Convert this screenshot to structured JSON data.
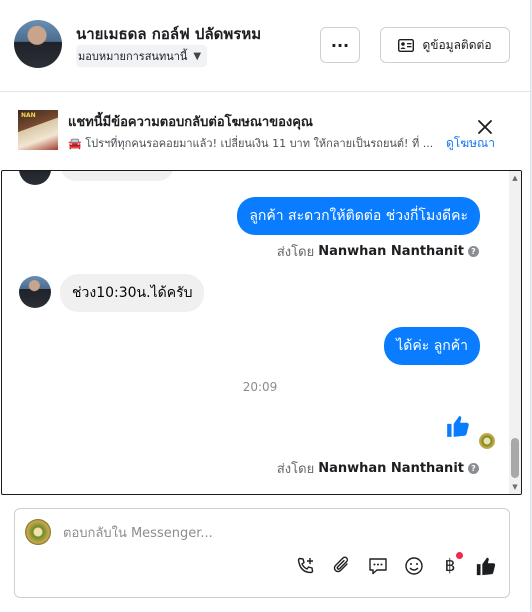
{
  "header": {
    "name": "นายเมธดล กอล์ฟ ปลัดพรหม",
    "assign_label": "มอบหมายการสนทนานี้",
    "more_label": "···",
    "contact_label": "ดูข้อมูลติดต่อ"
  },
  "ad_banner": {
    "title": "แชทนี้มีข้อความตอบกลับต่อโฆษณาของคุณ",
    "subtitle": "🚘 โปรฯที่ทุกคนรอคอยมาแล้ว! เปลี่ยนเงิน 11 บาท ให้กลายเป็นรถยนต์! ที่ ...",
    "link": "ดูโฆษณา",
    "thumb_tag": "NAN"
  },
  "messages": [
    {
      "direction": "out",
      "text": "ลูกค้า สะดวกให้ติดต่อ ช่วงกี่โมงดีคะ"
    },
    {
      "direction": "in",
      "text": "ช่วง10:30น.ได้ครับ"
    },
    {
      "direction": "out",
      "text": "ได้ค่ะ  ลูกค้า"
    }
  ],
  "sent_by": {
    "prefix": "ส่งโดย",
    "name": "Nanwhan Nanthanit"
  },
  "timestamp": "20:09",
  "composer": {
    "placeholder": "ตอบกลับใน Messenger..."
  },
  "colors": {
    "accent": "#0a7cff",
    "link": "#1877f2",
    "notification": "#f02849"
  },
  "icons": [
    "more-icon",
    "contact-card-icon",
    "close-icon",
    "info-icon",
    "like-icon",
    "add-call-icon",
    "attachment-icon",
    "saved-reply-icon",
    "emoji-icon",
    "baht-payment-icon"
  ]
}
